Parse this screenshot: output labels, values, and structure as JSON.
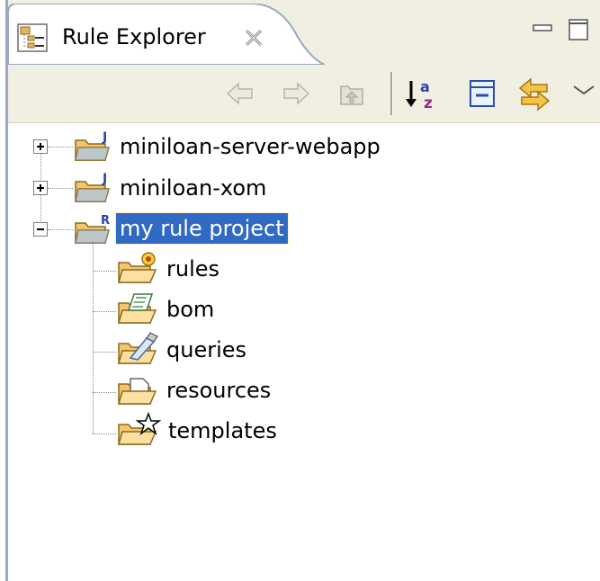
{
  "view": {
    "title": "Rule Explorer"
  },
  "toolbar": {
    "buttons": [
      "back-arrow-icon",
      "forward-arrow-icon",
      "up-folder-icon",
      "sort-alpha-icon",
      "collapse-all-icon",
      "link-with-editor-icon",
      "view-menu-icon"
    ]
  },
  "tree": {
    "projects": [
      {
        "label": "miniloan-server-webapp",
        "badge": "J",
        "expanded": false
      },
      {
        "label": "miniloan-xom",
        "badge": "J",
        "expanded": false
      },
      {
        "label": "my rule project",
        "badge": "R",
        "expanded": true,
        "selected": true
      }
    ],
    "children": [
      {
        "label": "rules",
        "icon": "rules-folder-icon"
      },
      {
        "label": "bom",
        "icon": "bom-folder-icon"
      },
      {
        "label": "queries",
        "icon": "queries-folder-icon"
      },
      {
        "label": "resources",
        "icon": "resources-folder-icon"
      },
      {
        "label": "templates",
        "icon": "templates-folder-icon"
      }
    ]
  },
  "colors": {
    "selection": "#316ac5",
    "toolbar_bg": "#f1efe2",
    "folder": "#f5c46b",
    "badge_j": "#2a3fb0",
    "badge_r": "#2a3fb0"
  }
}
